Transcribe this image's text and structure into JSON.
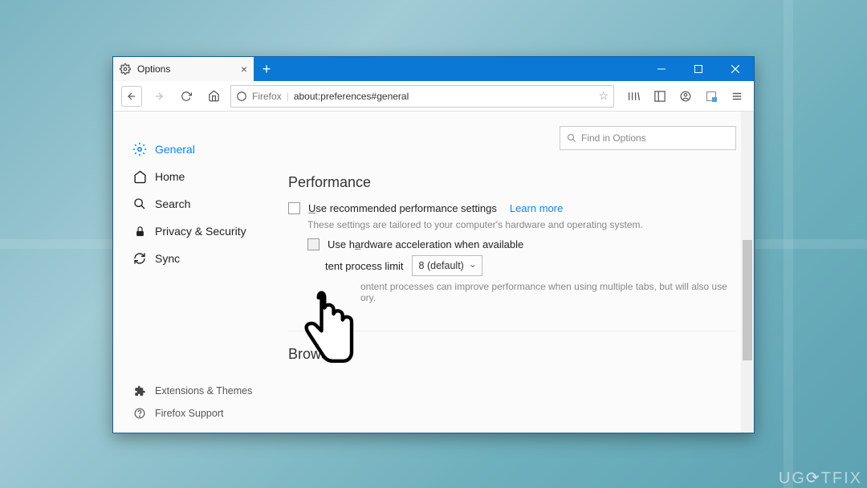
{
  "tab": {
    "title": "Options"
  },
  "url": {
    "identity": "Firefox",
    "address": "about:preferences#general"
  },
  "sidebar": {
    "items": [
      {
        "label": "General"
      },
      {
        "label": "Home"
      },
      {
        "label": "Search"
      },
      {
        "label": "Privacy & Security"
      },
      {
        "label": "Sync"
      }
    ],
    "footer": [
      {
        "label": "Extensions & Themes"
      },
      {
        "label": "Firefox Support"
      }
    ]
  },
  "search": {
    "placeholder": "Find in Options"
  },
  "performance": {
    "heading": "Performance",
    "recommended_label": "se recommended performance settings",
    "recommended_prefix": "U",
    "learn_more": "Learn more",
    "hint1": "These settings are tailored to your computer's hardware and operating system.",
    "hwaccel_prefix": "Use h",
    "hwaccel_mid": "a",
    "hwaccel_rest": "rdware acceleration when available",
    "limit_label": "tent process limit",
    "limit_value": "8 (default)",
    "hint2_a": "ontent processes can improve performance when using multiple tabs, but will also use",
    "hint2_b": "ory."
  },
  "browsing": {
    "heading": "Browsing"
  },
  "watermark": {
    "a": "UG",
    "b": "T",
    "c": "FIX"
  }
}
